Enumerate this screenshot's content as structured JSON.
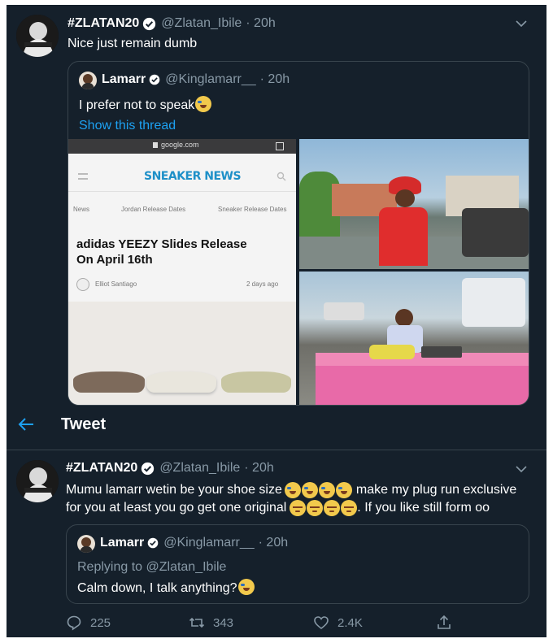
{
  "top_tweet": {
    "display_name": "#ZLATAN20",
    "handle": "@Zlatan_Ibile",
    "time": "· 20h",
    "text": "Nice just remain dumb",
    "quote": {
      "display_name": "Lamarr",
      "handle": "@Kinglamarr__",
      "time": "· 20h",
      "text": "I prefer not to speak",
      "show_thread": "Show this thread",
      "screenshot": {
        "browser_url": "google.com",
        "site_logo": "SNEAKER NEWS",
        "nav": [
          "News",
          "Jordan Release Dates",
          "Sneaker Release Dates"
        ],
        "headline_line1": "adidas YEEZY Slides Release",
        "headline_line2": "On April 16th",
        "author": "Elliot Santiago",
        "posted": "2 days ago"
      }
    }
  },
  "header": {
    "back_icon": "arrow-left-icon",
    "title": "Tweet"
  },
  "main_tweet": {
    "display_name": "#ZLATAN20",
    "handle": "@Zlatan_Ibile",
    "time": "· 20h",
    "text_line1_a": "Mumu lamarr wetin be your shoe size",
    "text_line1_b": "make my plug run exclusive",
    "text_line2_a": "for you at least you go get one original",
    "text_line2_b": ". If you like still form oo",
    "quote": {
      "display_name": "Lamarr",
      "handle": "@Kinglamarr__",
      "time": "· 20h",
      "replying_to": "Replying to @Zlatan_Ibile",
      "text": "Calm down, I talk anything?"
    },
    "actions": {
      "replies": "225",
      "retweets": "343",
      "likes": "2.4K"
    }
  },
  "colors": {
    "background": "#15202b",
    "border": "#38444d",
    "muted": "#8899a6",
    "accent": "#1da1f2"
  }
}
